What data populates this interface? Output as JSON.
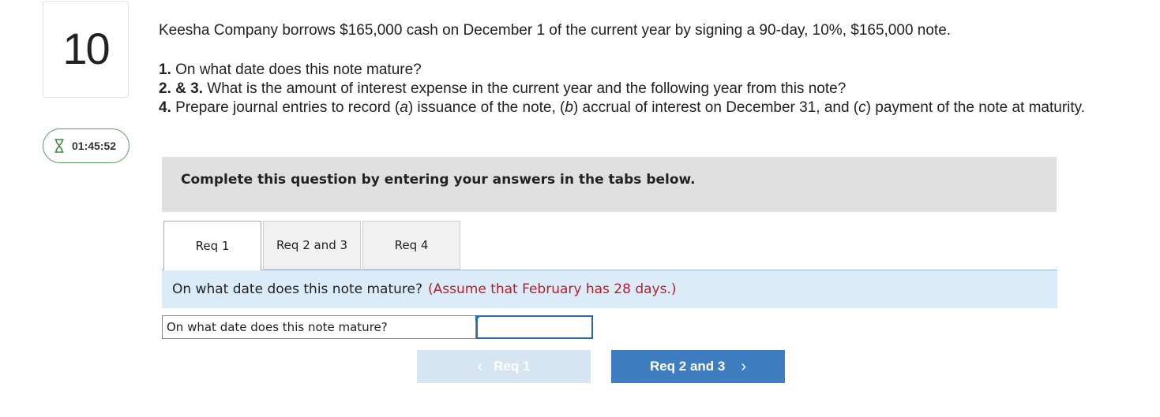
{
  "question": {
    "number": "10",
    "timer": "01:45:52",
    "timer_icon": "hourglass-icon",
    "intro": "Keesha Company borrows $165,000 cash on December 1 of the current year by signing a 90-day, 10%, $165,000 note.",
    "items": [
      {
        "num": "1.",
        "text": " On what date does this note mature?"
      },
      {
        "num": "2. & 3.",
        "text": " What is the amount of interest expense in the current year and the following year from this note?"
      },
      {
        "num": "4.",
        "text_before": " Prepare journal entries to record (",
        "a": "a",
        "t1": ") issuance of the note, (",
        "b": "b",
        "t2": ") accrual of interest on December 31, and (",
        "c": "c",
        "t3": ") payment of the note at maturity."
      }
    ]
  },
  "instructions": "Complete this question by entering your answers in the tabs below.",
  "tabs": [
    {
      "label": "Req 1",
      "active": true
    },
    {
      "label": "Req 2 and 3",
      "active": false
    },
    {
      "label": "Req 4",
      "active": false
    }
  ],
  "req1": {
    "prompt": "On what date does this note mature?",
    "note": "(Assume that February has 28 days.)",
    "answer_label": "On what date does this note mature?",
    "answer_value": ""
  },
  "nav": {
    "prev_label": "Req 1",
    "prev_icon": "chevron-left-icon",
    "next_label": "Req 2 and 3",
    "next_icon": "chevron-right-icon",
    "prev_color": "#d7e5f3",
    "next_color": "#3f7dc1"
  },
  "colors": {
    "timer_border": "#5a9b5e",
    "note_red": "#b11f2e",
    "question_bar": "#dcebf8",
    "instructions_bg": "#e0e0e0"
  }
}
